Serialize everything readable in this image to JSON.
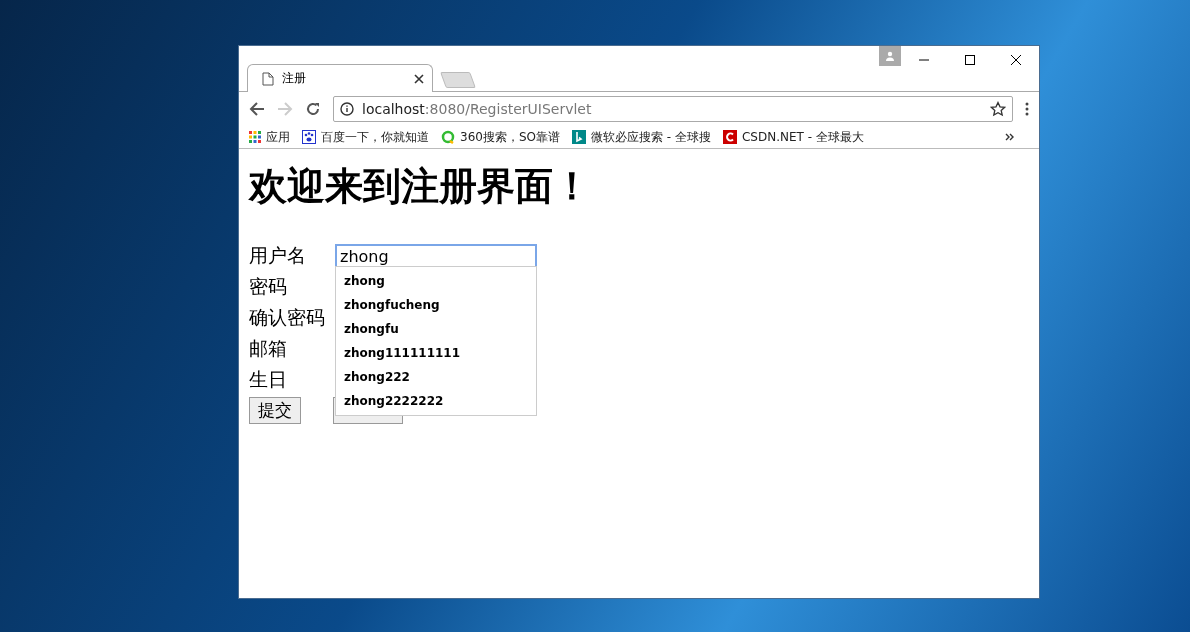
{
  "window": {
    "tab_title": "注册",
    "address": {
      "host": "localhost",
      "rest": ":8080/RegisterUIServlet"
    }
  },
  "bookmarks": [
    {
      "label": "应用",
      "kind": "apps"
    },
    {
      "label": "百度一下，你就知道",
      "kind": "paw"
    },
    {
      "label": "360搜索，SO靠谱",
      "kind": "ring"
    },
    {
      "label": "微软必应搜索 - 全球搜",
      "kind": "bing"
    },
    {
      "label": "CSDN.NET - 全球最大",
      "kind": "csdn"
    }
  ],
  "page": {
    "heading": "欢迎来到注册界面！",
    "fields": [
      {
        "label": "用户名",
        "value": "zhong",
        "focused": true
      },
      {
        "label": "密码"
      },
      {
        "label": "确认密码"
      },
      {
        "label": "邮箱"
      },
      {
        "label": "生日"
      }
    ],
    "submit": "提交",
    "autocomplete": [
      "zhong",
      "zhongfucheng",
      "zhongfu",
      "zhong111111111",
      "zhong222",
      "zhong2222222"
    ]
  }
}
